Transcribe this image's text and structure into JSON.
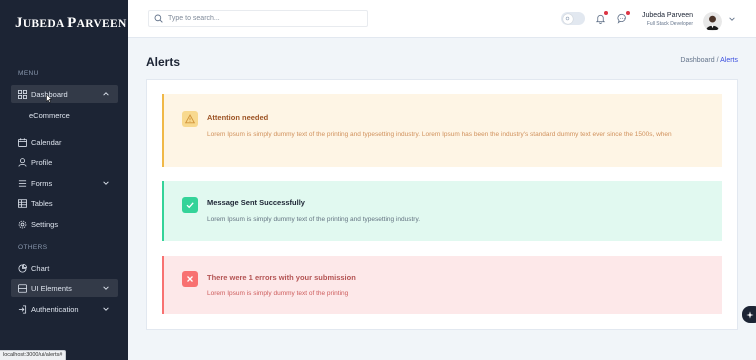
{
  "brand": {
    "initial": "J",
    "name": "UBEDA",
    "initial2": "P",
    "name2": "ARVEEN"
  },
  "sidebar": {
    "menu_title": "MENU",
    "others_title": "OTHERS",
    "items": [
      {
        "label": "Dashboard",
        "icon": "grid-icon",
        "expanded": true
      },
      {
        "label": "eCommerce"
      },
      {
        "label": "Calendar",
        "icon": "calendar-icon"
      },
      {
        "label": "Profile",
        "icon": "user-icon"
      },
      {
        "label": "Forms",
        "icon": "list-icon"
      },
      {
        "label": "Tables",
        "icon": "table-icon"
      },
      {
        "label": "Settings",
        "icon": "gear-icon"
      }
    ],
    "others": [
      {
        "label": "Chart",
        "icon": "pie-chart-icon"
      },
      {
        "label": "UI Elements",
        "icon": "layers-icon"
      },
      {
        "label": "Authentication",
        "icon": "login-icon"
      }
    ]
  },
  "status_url": "localhost:3000/ui/alerts#",
  "header": {
    "search_placeholder": "Type to search...",
    "user_name": "Jubeda Parveen",
    "user_role": "Full Stack Developer"
  },
  "page": {
    "title": "Alerts",
    "breadcrumb_parent": "Dashboard /",
    "breadcrumb_current": "Alerts"
  },
  "alerts": {
    "warning": {
      "title": "Attention needed",
      "body": "Lorem Ipsum is simply dummy text of the printing and typesetting industry. Lorem Ipsum has been the industry's standard dummy text ever since the 1500s, when"
    },
    "success": {
      "title": "Message Sent Successfully",
      "body": "Lorem Ipsum is simply dummy text of the printing and typesetting industry."
    },
    "error": {
      "title": "There were 1 errors with your submission",
      "body": "Lorem Ipsum is simply dummy text of the printing"
    }
  },
  "colors": {
    "sidebar_bg": "#1c2434",
    "accent": "#3c50e0",
    "warning": "#f0b847",
    "success": "#34d399",
    "error": "#f87171"
  }
}
